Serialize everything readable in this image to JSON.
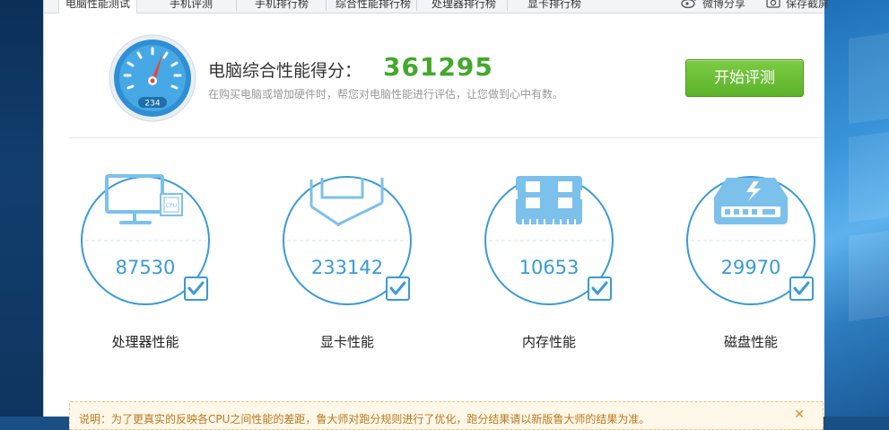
{
  "tabs": [
    {
      "label": "电脑性能测试",
      "active": true
    },
    {
      "label": "手机评测",
      "active": false
    },
    {
      "label": "手机排行榜",
      "active": false
    },
    {
      "label": "综合性能排行榜",
      "active": false
    },
    {
      "label": "处理器排行榜",
      "active": false
    },
    {
      "label": "显卡排行榜",
      "active": false
    }
  ],
  "toolbar": {
    "weibo_share": "微博分享",
    "save_screenshot": "保存截屏"
  },
  "header": {
    "gauge_reading": "234",
    "score_label": "电脑综合性能得分：",
    "score_value": "361295",
    "subtitle": "在购买电脑或增加硬件时，帮您对电脑性能进行评估，让您做到心中有数。",
    "start_button": "开始评测"
  },
  "metrics": [
    {
      "name": "cpu",
      "value": "87530",
      "label": "处理器性能",
      "checked": true
    },
    {
      "name": "gpu",
      "value": "233142",
      "label": "显卡性能",
      "checked": true
    },
    {
      "name": "memory",
      "value": "10653",
      "label": "内存性能",
      "checked": true
    },
    {
      "name": "disk",
      "value": "29970",
      "label": "磁盘性能",
      "checked": true
    }
  ],
  "notice": {
    "text": "说明：为了更真实的反映各CPU之间性能的差距，鲁大师对跑分规则进行了优化，跑分结果请以新版鲁大师的结果为准。"
  },
  "colors": {
    "accent_blue": "#3a9ad8",
    "score_green": "#43a82b",
    "button_green": "#5cb32a",
    "notice_orange": "#b7791f"
  }
}
